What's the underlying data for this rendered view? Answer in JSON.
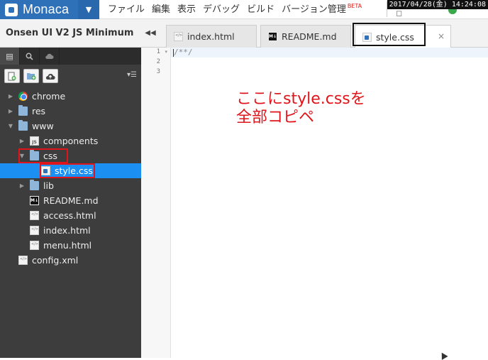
{
  "app": {
    "logo": "Monaca",
    "menu": [
      "ファイル",
      "編集",
      "表示",
      "デバッグ",
      "ビルド",
      "バージョン管理"
    ],
    "beta_badge": "BETA",
    "clock": "2017/04/28(金) 14:24:08"
  },
  "sidebar": {
    "project_title": "Onsen UI V2 JS Minimum",
    "tree": [
      {
        "label": "chrome",
        "icon": "chrome-icon",
        "depth": 0,
        "arrow": "▶"
      },
      {
        "label": "res",
        "icon": "folder-icon",
        "depth": 0,
        "arrow": "▶"
      },
      {
        "label": "www",
        "icon": "folder-icon",
        "depth": 0,
        "arrow": "▼"
      },
      {
        "label": "components",
        "icon": "js-file-icon",
        "depth": 1,
        "arrow": "▶"
      },
      {
        "label": "css",
        "icon": "folder-icon",
        "depth": 1,
        "arrow": "▼"
      },
      {
        "label": "style.css",
        "icon": "css-file-icon",
        "depth": 2,
        "arrow": ""
      },
      {
        "label": "lib",
        "icon": "folder-icon",
        "depth": 1,
        "arrow": "▶"
      },
      {
        "label": "README.md",
        "icon": "markdown-file-icon",
        "depth": 1,
        "arrow": ""
      },
      {
        "label": "access.html",
        "icon": "html-file-icon",
        "depth": 1,
        "arrow": ""
      },
      {
        "label": "index.html",
        "icon": "html-file-icon",
        "depth": 1,
        "arrow": ""
      },
      {
        "label": "menu.html",
        "icon": "html-file-icon",
        "depth": 1,
        "arrow": ""
      },
      {
        "label": "config.xml",
        "icon": "xml-file-icon",
        "depth": 0,
        "arrow": ""
      }
    ],
    "selected": "style.css"
  },
  "editor": {
    "tabs": [
      {
        "label": "index.html"
      },
      {
        "label": "README.md"
      },
      {
        "label": "style.css",
        "close": "×"
      }
    ],
    "line_numbers": [
      "1",
      "2",
      "3"
    ],
    "code_line1": "/**/",
    "annotation_line1": "ここにstyle.cssを",
    "annotation_line2": "全部コピペ"
  },
  "colors": {
    "brand": "#2f71b8",
    "selected_row": "#1c8ff3",
    "highlight": "#e0141b"
  }
}
